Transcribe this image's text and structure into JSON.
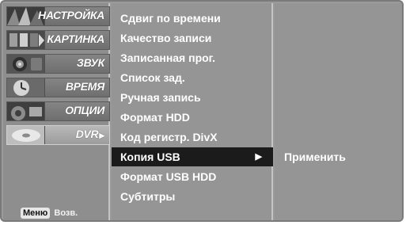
{
  "sidebar": {
    "categories": [
      {
        "label": "НАСТРОЙКА",
        "icon": "setup-icon"
      },
      {
        "label": "КАРТИНКА",
        "icon": "picture-icon"
      },
      {
        "label": "ЗВУК",
        "icon": "audio-icon"
      },
      {
        "label": "ВРЕМЯ",
        "icon": "clock-icon"
      },
      {
        "label": "ОПЦИИ",
        "icon": "options-icon"
      },
      {
        "label": "DVR",
        "icon": "dvr-disc-icon",
        "selected": true,
        "arrow": "▶"
      }
    ],
    "hint_key": "Меню",
    "hint_text": "Возв."
  },
  "submenu": {
    "items": [
      {
        "label": "Сдвиг по времени"
      },
      {
        "label": "Качество записи"
      },
      {
        "label": "Записанная прог."
      },
      {
        "label": "Список зад."
      },
      {
        "label": "Ручная запись"
      },
      {
        "label": "Формат HDD"
      },
      {
        "label": "Код регистр. DivX"
      },
      {
        "label": "Копия USB",
        "selected": true,
        "arrow": "▶"
      },
      {
        "label": "Формат USB HDD"
      },
      {
        "label": "Субтитры"
      }
    ]
  },
  "panel": {
    "options": [
      {
        "label": "Применить"
      }
    ]
  },
  "colors": {
    "frame": "#9a9a9a",
    "highlight": "#1b1b1b",
    "text": "#ffffff"
  }
}
